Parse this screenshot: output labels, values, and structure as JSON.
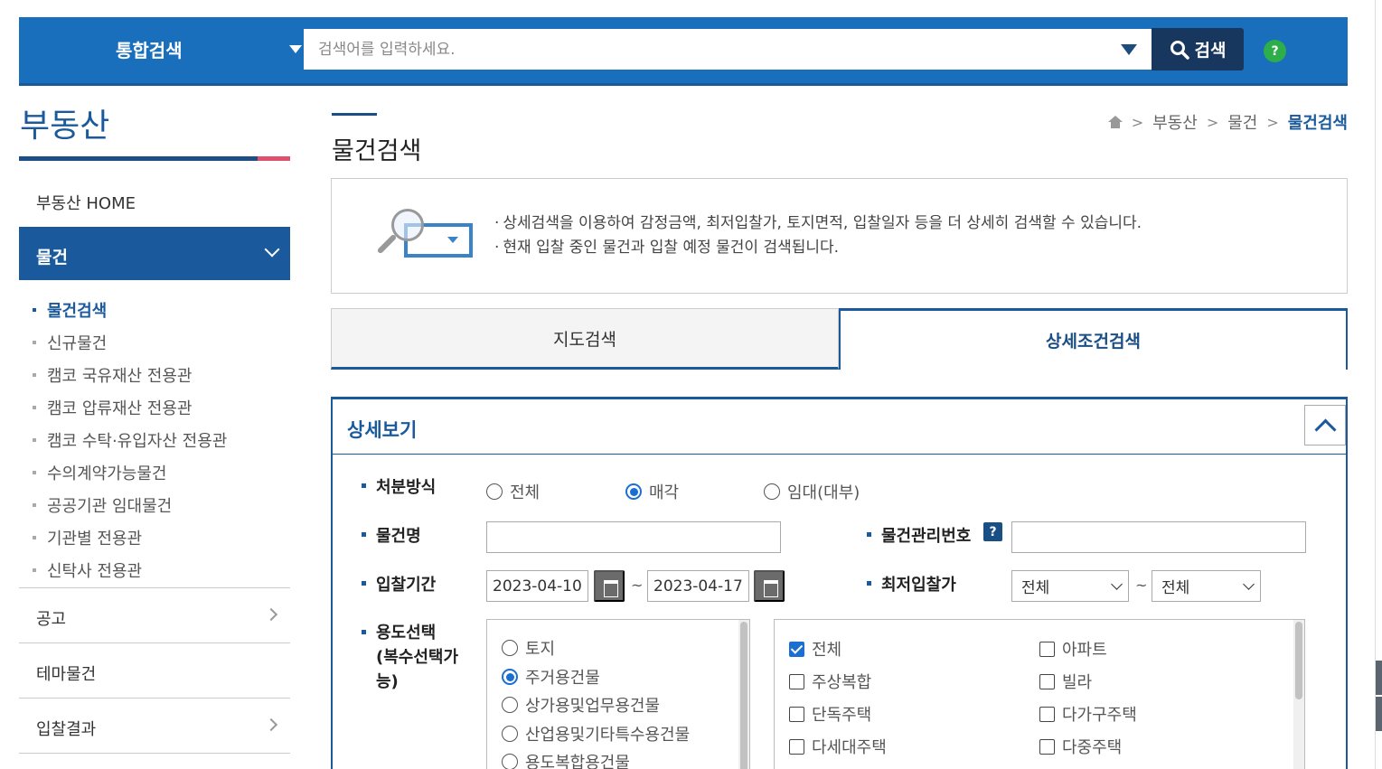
{
  "topbar": {
    "category": "통합검색",
    "search_placeholder": "검색어를 입력하세요.",
    "search_button": "검색",
    "help": "?"
  },
  "sidebar": {
    "title": "부동산",
    "home": "부동산 HOME",
    "active_section": "물건",
    "sub_items": [
      {
        "label": "물건검색",
        "current": true
      },
      {
        "label": "신규물건"
      },
      {
        "label": "캠코 국유재산 전용관"
      },
      {
        "label": "캠코 압류재산 전용관"
      },
      {
        "label": "캠코 수탁·유입자산 전용관"
      },
      {
        "label": "수의계약가능물건"
      },
      {
        "label": "공공기관 임대물건"
      },
      {
        "label": "기관별 전용관"
      },
      {
        "label": "신탁사 전용관"
      }
    ],
    "menu": [
      "공고",
      "테마물건",
      "입찰결과"
    ]
  },
  "main": {
    "page_title": "물건검색",
    "breadcrumb": [
      "부동산",
      "물건",
      "물건검색"
    ],
    "info": [
      "상세검색을 이용하여 감정금액, 최저입찰가, 토지면적, 입찰일자 등을 더 상세히 검색할 수 있습니다.",
      "현재 입찰 중인 물건과 입찰 예정 물건이 검색됩니다."
    ],
    "tabs": {
      "map": "지도검색",
      "detail": "상세조건검색"
    },
    "detail": {
      "header": "상세보기",
      "disposal_label": "처분방식",
      "disposal_options": [
        "전체",
        "매각",
        "임대(대부)"
      ],
      "disposal_selected": "매각",
      "item_name_label": "물건명",
      "item_mgmt_label": "물건관리번호",
      "bid_period_label": "입찰기간",
      "bid_start": "2023-04-10",
      "bid_end": "2023-04-17",
      "tilde": "~",
      "min_bid_label": "최저입찰가",
      "min_bid_from": "전체",
      "min_bid_to": "전체",
      "usage_label": "용도선택",
      "usage_label2": "(복수선택가",
      "usage_label3": "능)",
      "usage_radios": [
        "토지",
        "주거용건물",
        "상가용및업무용건물",
        "산업용및기타특수용건물",
        "용도복합용건물"
      ],
      "usage_selected": "주거용건물",
      "usage_checks_left": [
        "전체",
        "주상복합",
        "단독주택",
        "다세대주택"
      ],
      "usage_checks_right": [
        "아파트",
        "빌라",
        "다가구주택",
        "다중주택"
      ],
      "usage_checked": "전체"
    }
  }
}
